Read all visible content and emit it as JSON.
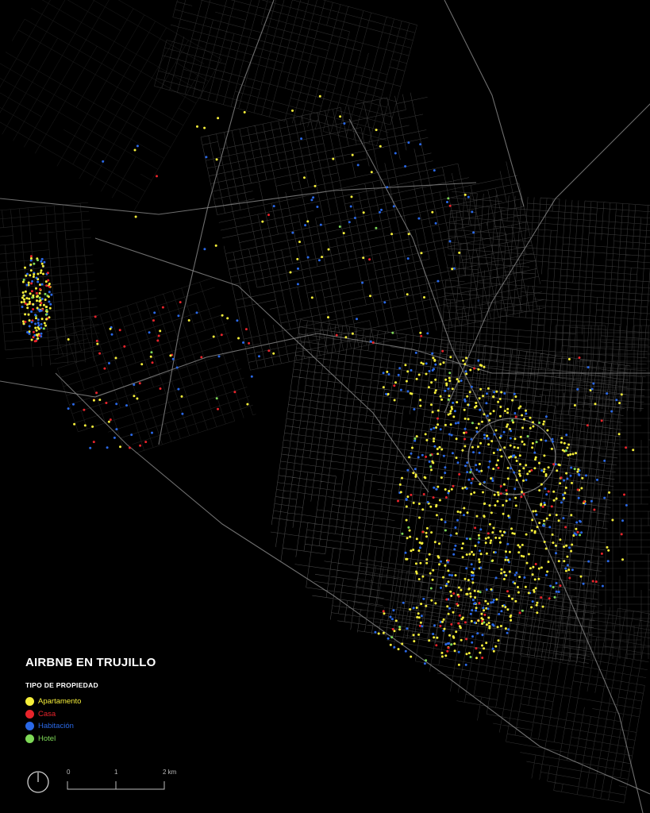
{
  "map": {
    "title": "AIRBNB EN TRUJILLO",
    "legend_title": "TIPO DE PROPIEDAD",
    "legend": [
      {
        "key": "apartamento",
        "label": "Apartamento",
        "color": "#f6ef3a"
      },
      {
        "key": "casa",
        "label": "Casa",
        "color": "#e8242b"
      },
      {
        "key": "habitacion",
        "label": "Habitación",
        "color": "#2a68e6"
      },
      {
        "key": "hotel",
        "label": "Hotel",
        "color": "#7ed957"
      }
    ],
    "scale": {
      "labels": [
        "0",
        "1",
        "2 km"
      ]
    },
    "background": "#000000",
    "street_color": "#6b6b6b",
    "north_arrow_icon": "north-arrow-icon"
  }
}
